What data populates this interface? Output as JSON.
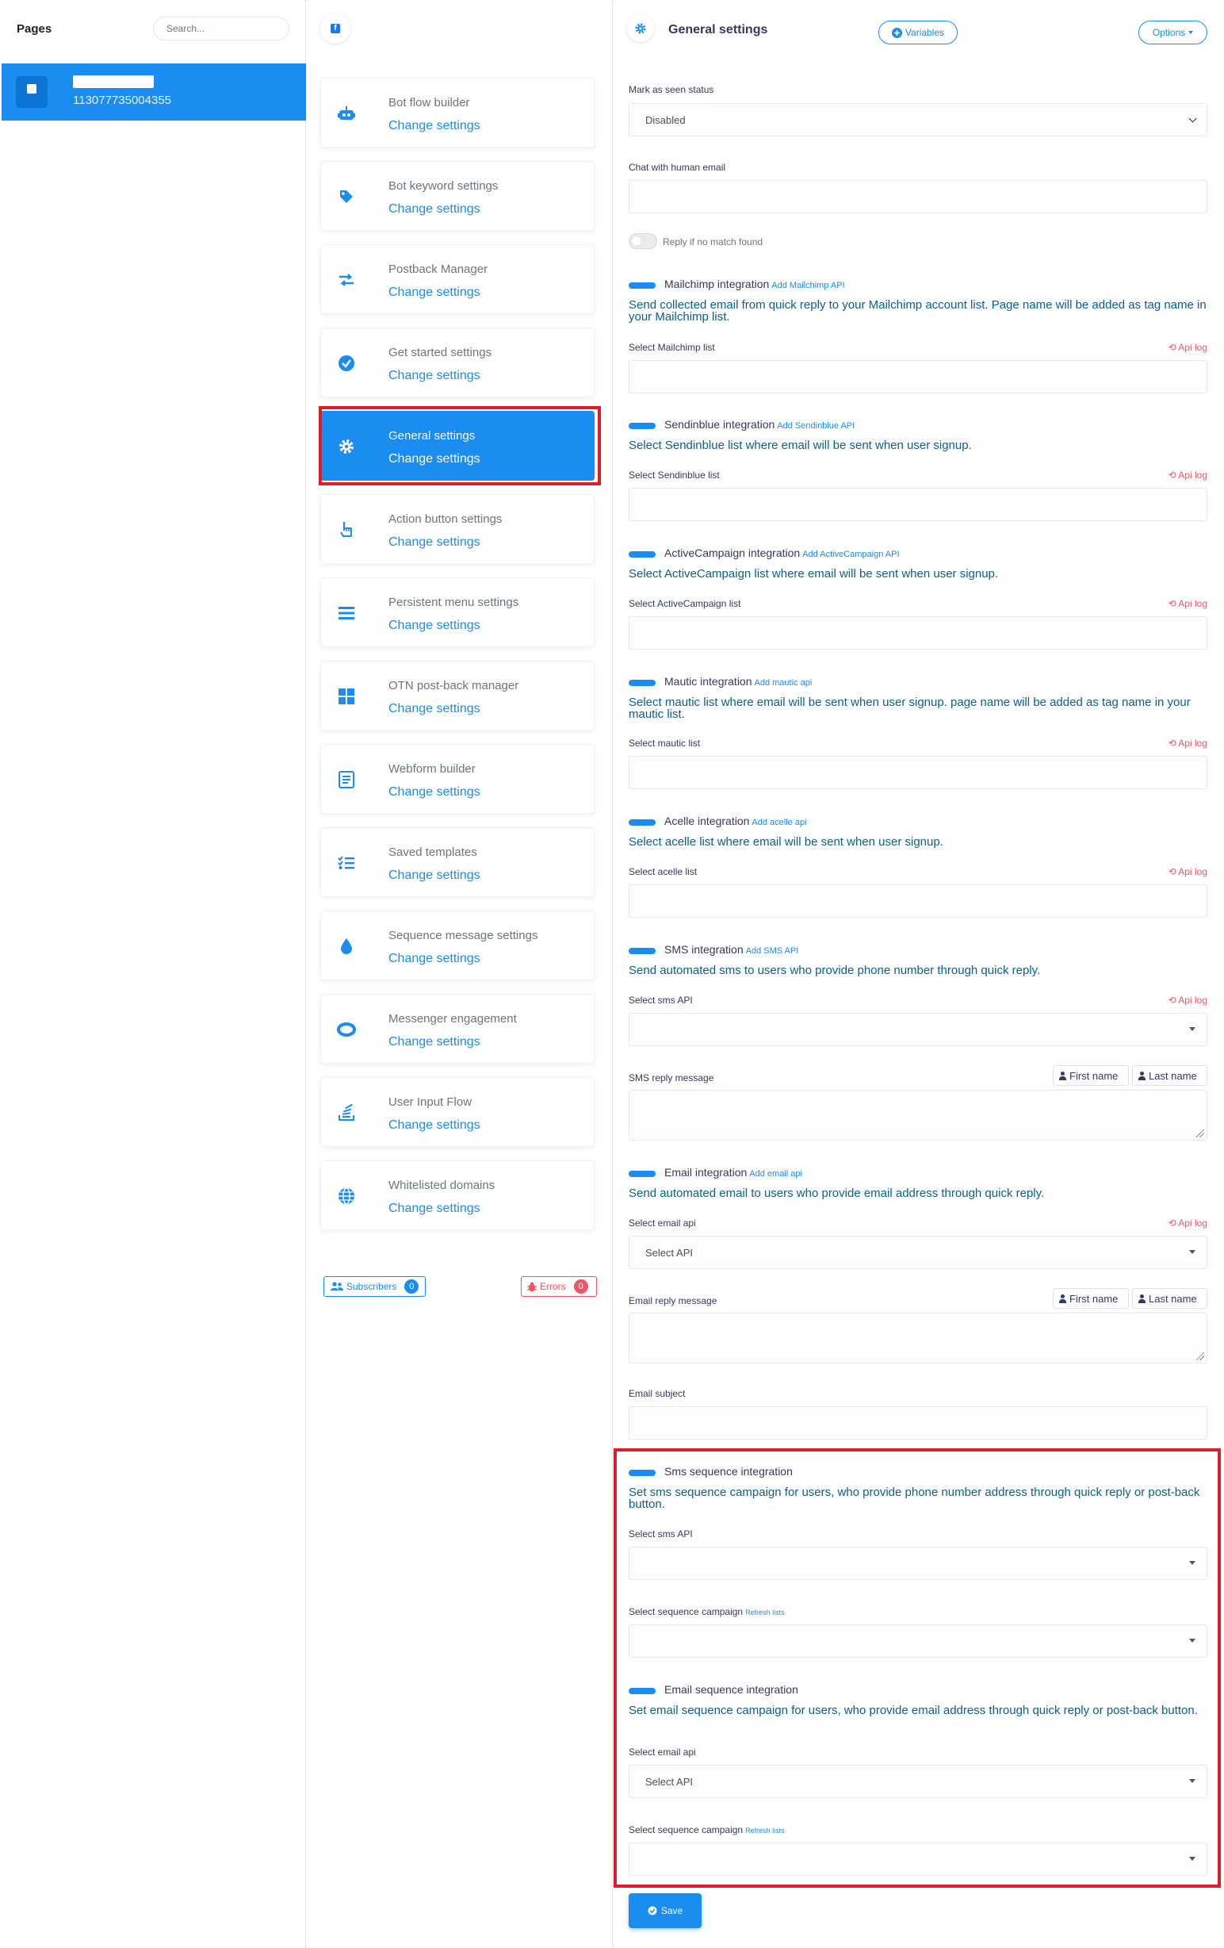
{
  "pages_panel": {
    "title": "Pages",
    "search_placeholder": "Search...",
    "page": {
      "id": "113077735004355"
    }
  },
  "menu": {
    "items": [
      {
        "title": "Bot flow builder",
        "link": "Change settings",
        "icon": "robot-icon"
      },
      {
        "title": "Bot keyword settings",
        "link": "Change settings",
        "icon": "tag-icon"
      },
      {
        "title": "Postback Manager",
        "link": "Change settings",
        "icon": "exchange-icon"
      },
      {
        "title": "Get started settings",
        "link": "Change settings",
        "icon": "check-circle-icon"
      },
      {
        "title": "General settings",
        "link": "Change settings",
        "icon": "gear-icon",
        "active": true
      },
      {
        "title": "Action button settings",
        "link": "Change settings",
        "icon": "hand-pointer-icon"
      },
      {
        "title": "Persistent menu settings",
        "link": "Change settings",
        "icon": "bars-icon"
      },
      {
        "title": "OTN post-back manager",
        "link": "Change settings",
        "icon": "windows-icon"
      },
      {
        "title": "Webform builder",
        "link": "Change settings",
        "icon": "form-icon"
      },
      {
        "title": "Saved templates",
        "link": "Change settings",
        "icon": "list-check-icon"
      },
      {
        "title": "Sequence message settings",
        "link": "Change settings",
        "icon": "drop-icon"
      },
      {
        "title": "Messenger engagement",
        "link": "Change settings",
        "icon": "ring-icon"
      },
      {
        "title": "User Input Flow",
        "link": "Change settings",
        "icon": "stack-icon"
      },
      {
        "title": "Whitelisted domains",
        "link": "Change settings",
        "icon": "globe-icon"
      }
    ],
    "subscribers_label": "Subscribers",
    "subscribers_count": "0",
    "errors_label": "Errors",
    "errors_count": "0"
  },
  "general": {
    "title": "General settings",
    "variables_label": "Variables",
    "options_label": "Options",
    "mark_seen_label": "Mark as seen status",
    "mark_seen_value": "Disabled",
    "chat_human_label": "Chat with human email",
    "reply_no_match_label": "Reply if no match found",
    "api_log": "Api log",
    "mailchimp": {
      "title": "Mailchimp integration",
      "link": "Add Mailchimp API",
      "desc": "Send collected email from quick reply to your Mailchimp account list. Page name will be added as tag name in your Mailchimp list.",
      "select_label": "Select Mailchimp list"
    },
    "sendinblue": {
      "title": "Sendinblue integration",
      "link": "Add Sendinblue API",
      "desc": "Select Sendinblue list where email will be sent when user signup.",
      "select_label": "Select Sendinblue list"
    },
    "activecampaign": {
      "title": "ActiveCampaign integration",
      "link": "Add ActiveCampaign API",
      "desc": "Select ActiveCampaign list where email will be sent when user signup.",
      "select_label": "Select ActiveCampaign list"
    },
    "mautic": {
      "title": "Mautic integration",
      "link": "Add mautic api",
      "desc": "Select mautic list where email will be sent when user signup. page name will be added as tag name in your mautic list.",
      "select_label": "Select mautic list"
    },
    "acelle": {
      "title": "Acelle integration",
      "link": "Add acelle api",
      "desc": "Select acelle list where email will be sent when user signup.",
      "select_label": "Select acelle list"
    },
    "sms": {
      "title": "SMS integration",
      "link": "Add SMS API",
      "desc": "Send automated sms to users who provide phone number through quick reply.",
      "select_label": "Select sms API",
      "reply_label": "SMS reply message",
      "first_name": "First name",
      "last_name": "Last name"
    },
    "email": {
      "title": "Email integration",
      "link": "Add email api",
      "desc": "Send automated email to users who provide email address through quick reply.",
      "select_label": "Select email api",
      "select_value": "Select API",
      "reply_label": "Email reply message",
      "subject_label": "Email subject",
      "first_name": "First name",
      "last_name": "Last name"
    },
    "sms_sequence": {
      "title": "Sms sequence integration",
      "desc": "Set sms sequence campaign for users, who provide phone number address through quick reply or post-back button.",
      "select_label": "Select sms API",
      "campaign_label": "Select sequence campaign",
      "refresh": "Refresh lists"
    },
    "email_sequence": {
      "title": "Email sequence integration",
      "desc": "Set email sequence campaign for users, who provide email address through quick reply or post-back button.",
      "select_label": "Select email api",
      "select_value": "Select API",
      "campaign_label": "Select sequence campaign",
      "refresh": "Refresh lists"
    },
    "save_label": "Save"
  },
  "colors": {
    "accent": "#1b8cf0",
    "danger": "#f05566",
    "highlight": "#e21b2b"
  }
}
